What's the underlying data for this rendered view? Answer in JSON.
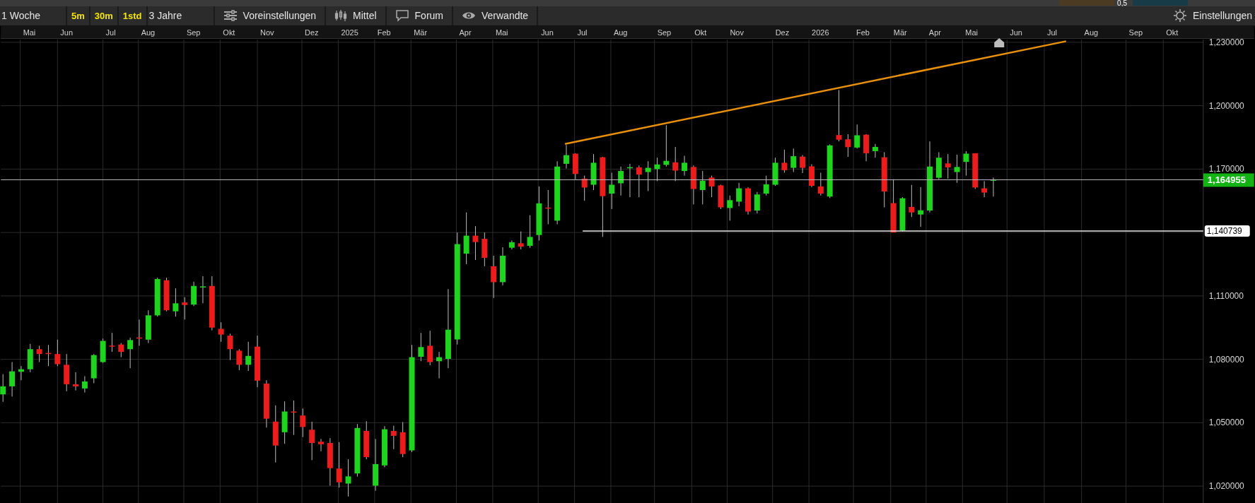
{
  "top_strip": {
    "value": "0,5"
  },
  "toolbar": {
    "items": [
      {
        "kind": "dropdown",
        "label": "1 Woche"
      },
      {
        "kind": "interval",
        "label": "5m"
      },
      {
        "kind": "interval",
        "label": "30m"
      },
      {
        "kind": "interval",
        "label": "1std"
      },
      {
        "kind": "dropdown",
        "label": "3 Jahre"
      },
      {
        "kind": "tool",
        "label": "Voreinstellungen"
      },
      {
        "kind": "tool",
        "label": "Mittel"
      },
      {
        "kind": "tool",
        "label": "Forum"
      },
      {
        "kind": "tool",
        "label": "Verwandte"
      }
    ],
    "settings": {
      "label": "Einstellungen"
    }
  },
  "chart": {
    "time_axis": [
      "Mai",
      "Jun",
      "Jul",
      "Aug",
      "Sep",
      "Okt",
      "Nov",
      "Dez",
      "2025",
      "Feb",
      "Mär",
      "Apr",
      "Mai",
      "Jun",
      "Jul",
      "Aug",
      "Sep",
      "Okt",
      "Nov",
      "Dez",
      "2026",
      "Feb",
      "Mär",
      "Apr",
      "Mai",
      "Jun",
      "Jul",
      "Aug",
      "Sep",
      "Okt"
    ],
    "price_axis": [
      "1,230000",
      "1,200000",
      "1,170000",
      "1,110000",
      "1,080000",
      "1,050000",
      "1,020000"
    ],
    "support_level": "1,140739",
    "last_price": "1,164955"
  }
}
